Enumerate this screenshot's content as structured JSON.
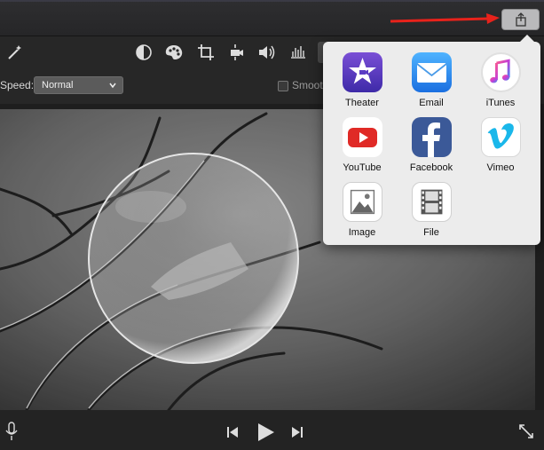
{
  "toolbar": {
    "tools": [
      "magic-wand",
      "color-balance",
      "color-correction",
      "crop",
      "stabilization",
      "volume",
      "equalizer"
    ]
  },
  "speed": {
    "label": "Speed:",
    "value": "Normal"
  },
  "smooth": {
    "label": "Smoot",
    "checked": false
  },
  "share_menu": {
    "items": [
      {
        "id": "theater",
        "label": "Theater",
        "icon": "star-film-icon",
        "color": "#5b3cc4"
      },
      {
        "id": "email",
        "label": "Email",
        "icon": "envelope-icon",
        "color": "#2c8ff0"
      },
      {
        "id": "itunes",
        "label": "iTunes",
        "icon": "music-note-icon",
        "color": "#e8338a"
      },
      {
        "id": "youtube",
        "label": "YouTube",
        "icon": "play-icon",
        "color": "#e02a26"
      },
      {
        "id": "facebook",
        "label": "Facebook",
        "icon": "facebook-f-icon",
        "color": "#3b5998"
      },
      {
        "id": "vimeo",
        "label": "Vimeo",
        "icon": "vimeo-v-icon",
        "color": "#1ab7ea"
      },
      {
        "id": "image",
        "label": "Image",
        "icon": "picture-icon",
        "color": "#ffffff"
      },
      {
        "id": "file",
        "label": "File",
        "icon": "film-strip-icon",
        "color": "#ffffff"
      }
    ]
  },
  "colors": {
    "annotation_arrow": "#e8221b",
    "popover_bg": "#ececec"
  }
}
